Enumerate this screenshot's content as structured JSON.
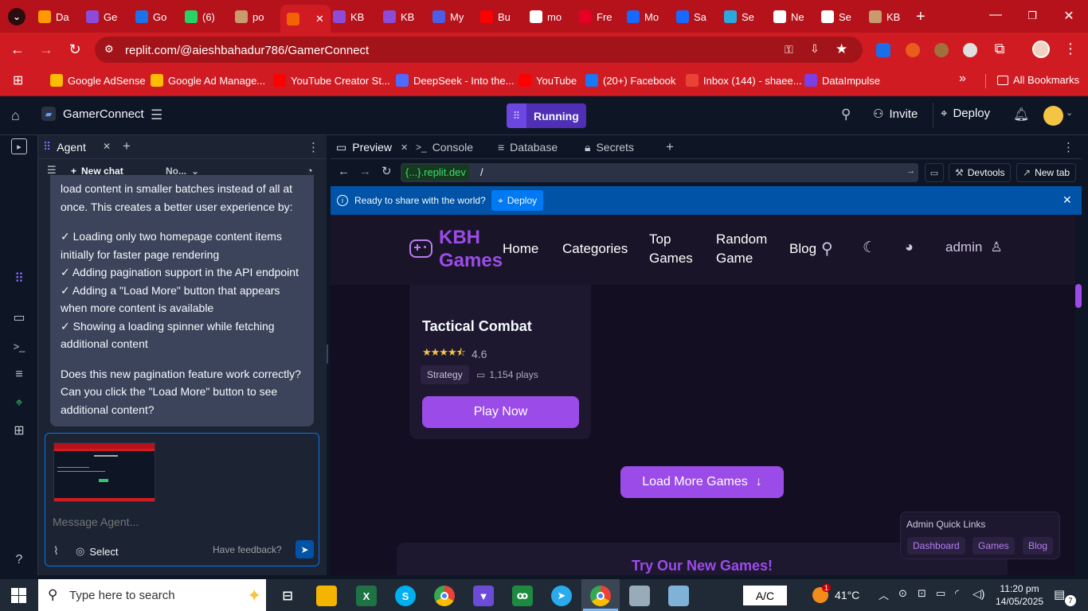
{
  "browser": {
    "tabs": [
      {
        "label": "Da",
        "icon": "letter-a-icon",
        "color": "#ff9900"
      },
      {
        "label": "Ge",
        "icon": "ge-icon",
        "color": "#8c4bd9"
      },
      {
        "label": "Go",
        "icon": "shield-icon",
        "color": "#1a73e8"
      },
      {
        "label": "(6)",
        "icon": "whatsapp-icon",
        "color": "#25d366"
      },
      {
        "label": "po",
        "icon": "avatar-icon",
        "color": "#c99a6b"
      },
      {
        "label": "",
        "icon": "replit-icon",
        "color": "#f26207",
        "active": true
      },
      {
        "label": "KB",
        "icon": "gamepad-icon",
        "color": "#8c4bd9"
      },
      {
        "label": "KB",
        "icon": "gamepad-icon",
        "color": "#8c4bd9"
      },
      {
        "label": "My",
        "icon": "my-icon",
        "color": "#4c5de8"
      },
      {
        "label": "Bu",
        "icon": "youtube-icon",
        "color": "#ff0000"
      },
      {
        "label": "mo",
        "icon": "google-icon",
        "color": "#ffffff"
      },
      {
        "label": "Fre",
        "icon": "pinterest-icon",
        "color": "#e60023"
      },
      {
        "label": "Mo",
        "icon": "behance-icon",
        "color": "#1769ff"
      },
      {
        "label": "Sa",
        "icon": "behance-icon",
        "color": "#1769ff"
      },
      {
        "label": "Se",
        "icon": "blocks-icon",
        "color": "#2aa8e0"
      },
      {
        "label": "Ne",
        "icon": "chrome-icon",
        "color": "#ffffff"
      },
      {
        "label": "Se",
        "icon": "gear-icon",
        "color": "#ffffff"
      },
      {
        "label": "KB",
        "icon": "avatar-icon",
        "color": "#c99a6b"
      }
    ],
    "url": "replit.com/@aieshbahadur786/GamerConnect",
    "bookmarks": [
      {
        "label": "Google AdSense",
        "color": "#fbbc04"
      },
      {
        "label": "Google Ad Manage...",
        "color": "#fbbc04"
      },
      {
        "label": "YouTube Creator St...",
        "color": "#ff0000"
      },
      {
        "label": "DeepSeek - Into the...",
        "color": "#4d6bfe"
      },
      {
        "label": "YouTube",
        "color": "#ff0000"
      },
      {
        "label": "(20+) Facebook",
        "color": "#1877f2"
      },
      {
        "label": "Inbox (144) - shaee...",
        "color": "#ea4335"
      },
      {
        "label": "DataImpulse",
        "color": "#7b3fe4"
      }
    ],
    "all_bookmarks": "All Bookmarks"
  },
  "replit": {
    "project_name": "GamerConnect",
    "run_status": "Running",
    "invite_label": "Invite",
    "deploy_label": "Deploy",
    "agent_tab": "Agent",
    "new_chat": "New chat",
    "model_dropdown": "No...",
    "message_paragraph1": "load content in smaller batches instead of all at once. This creates a better user experience by:",
    "checks": [
      "✓ Loading only two homepage content items initially for faster page rendering",
      "✓ Adding pagination support in the API endpoint",
      "✓ Adding a \"Load More\" button that appears when more content is available",
      "✓ Showing a loading spinner while fetching additional content"
    ],
    "message_question": "Does this new pagination feature work correctly? Can you click the \"Load More\" button to see additional content?",
    "input_placeholder": "Message Agent...",
    "select_label": "Select",
    "feedback_label": "Have feedback?",
    "preview_tabs": [
      "Preview",
      "Console",
      "Database",
      "Secrets"
    ],
    "preview_url_host": "{...}.replit.dev",
    "preview_url_path": "/",
    "devtools_label": "Devtools",
    "new_tab_label": "New tab",
    "banner_text": "Ready to share with the world?",
    "banner_button": "Deploy"
  },
  "site": {
    "logo_line1": "KBH",
    "logo_line2": "Games",
    "nav": {
      "home": "Home",
      "categories": "Categories",
      "top1": "Top",
      "top2": "Games",
      "random1": "Random",
      "random2": "Game",
      "blog": "Blog"
    },
    "user": "admin",
    "game_title": "Tactical Combat",
    "rating": "4.6",
    "stars": 4.5,
    "genre": "Strategy",
    "plays": "1,154 plays",
    "play_button": "Play Now",
    "load_more": "Load More Games",
    "quick_title": "Admin Quick Links",
    "quick_links": [
      "Dashboard",
      "Games",
      "Blog"
    ],
    "try_heading": "Try Our New Games!"
  },
  "taskbar": {
    "search_placeholder": "Type here to search",
    "keyboard": "A/C",
    "weather_badge": "1",
    "temperature": "41°C",
    "time": "11:20 pm",
    "date": "14/05/2025",
    "notification_count": "7"
  },
  "colors": {
    "accent": "#9b4ce8",
    "replit_blue": "#0079f2",
    "chrome_red": "#d11b22"
  }
}
